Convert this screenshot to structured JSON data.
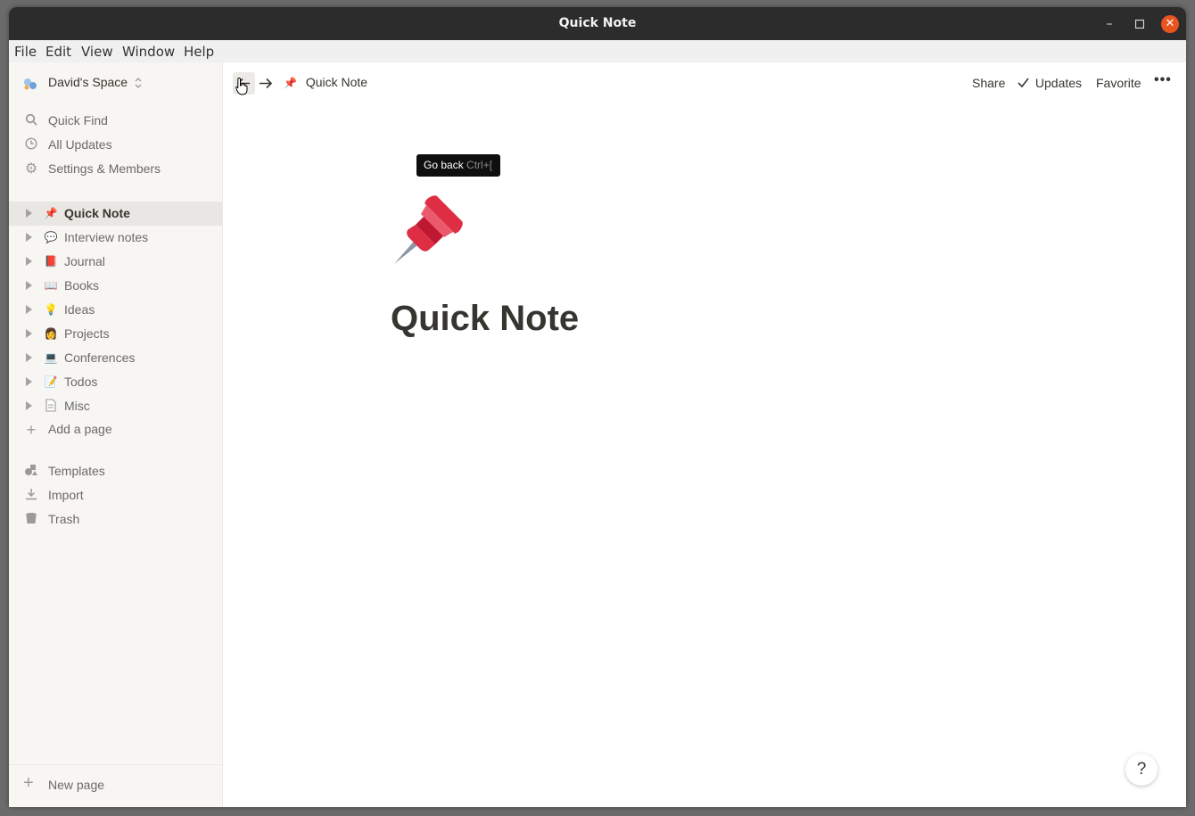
{
  "window": {
    "title": "Quick Note",
    "min_glyph": "–",
    "max_glyph": "□",
    "close_glyph": "✕"
  },
  "menu": [
    "File",
    "Edit",
    "View",
    "Window",
    "Help"
  ],
  "sidebar": {
    "workspace": "David's Space",
    "top_items": [
      {
        "label": "Quick Find",
        "icon": "search-icon"
      },
      {
        "label": "All Updates",
        "icon": "clock-icon"
      },
      {
        "label": "Settings & Members",
        "icon": "gear-icon"
      }
    ],
    "pages": [
      {
        "label": "Quick Note",
        "emoji": "📌",
        "active": true
      },
      {
        "label": "Interview notes",
        "emoji": "💬"
      },
      {
        "label": "Journal",
        "emoji": "📕"
      },
      {
        "label": "Books",
        "emoji": "📖"
      },
      {
        "label": "Ideas",
        "emoji": "💡"
      },
      {
        "label": "Projects",
        "emoji": "👩"
      },
      {
        "label": "Conferences",
        "emoji": "💻"
      },
      {
        "label": "Todos",
        "emoji": "📝"
      },
      {
        "label": "Misc",
        "emoji": "📄"
      }
    ],
    "add_page": "Add a page",
    "bottom_items": [
      {
        "label": "Templates",
        "icon": "templates-icon"
      },
      {
        "label": "Import",
        "icon": "import-icon"
      },
      {
        "label": "Trash",
        "icon": "trash-icon"
      }
    ],
    "new_page": "New page"
  },
  "topbar": {
    "breadcrumb": "Quick Note",
    "share": "Share",
    "updates": "Updates",
    "favorite": "Favorite",
    "more": "•••"
  },
  "tooltip": {
    "text": "Go back",
    "shortcut": "Ctrl+["
  },
  "page": {
    "title": "Quick Note",
    "icon": "pushpin-icon"
  },
  "help": "?",
  "colors": {
    "accent": "#e03e3e",
    "sidebar_bg": "#f7f6f3",
    "text": "#37352f"
  }
}
